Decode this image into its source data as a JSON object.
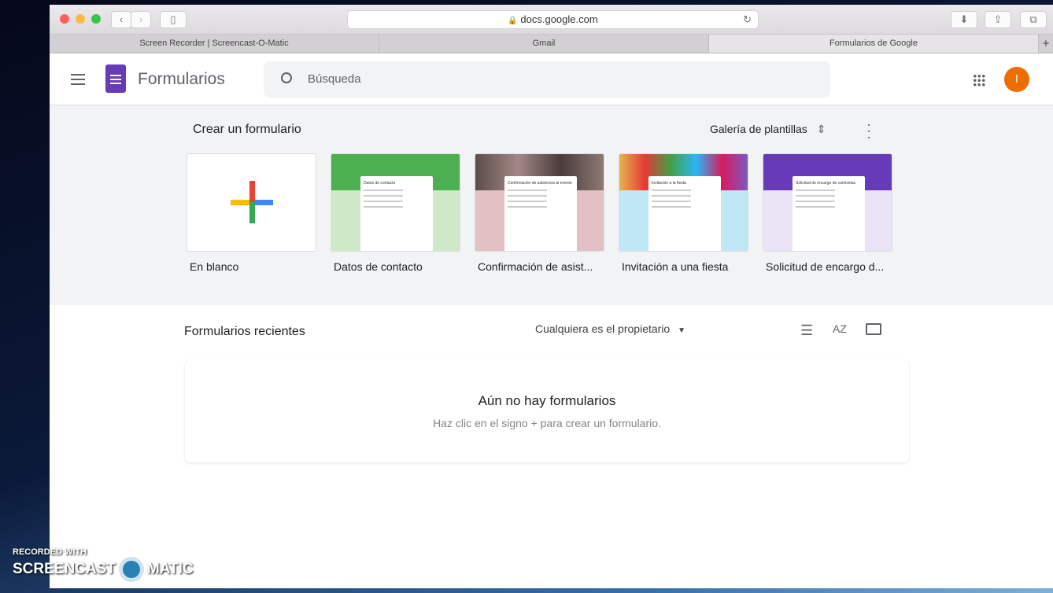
{
  "browser": {
    "url": "docs.google.com",
    "tabs": [
      "Screen Recorder | Screencast-O-Matic",
      "Gmail",
      "Formularios de Google"
    ],
    "new_tab": "+"
  },
  "app": {
    "name": "Formularios",
    "search_placeholder": "Búsqueda",
    "avatar_initial": "I"
  },
  "gallery": {
    "title": "Crear un formulario",
    "gallery_button": "Galería de plantillas",
    "templates": [
      {
        "label": "En blanco",
        "color": "#ffffff"
      },
      {
        "label": "Datos de contacto",
        "color": "#cfe8c8",
        "header": "#4caf50",
        "form_title": "Datos de contacto"
      },
      {
        "label": "Confirmación de asist...",
        "color": "#e2c0c4",
        "header": "#6d5a5a",
        "form_title": "Confirmación de asistencia al evento"
      },
      {
        "label": "Invitación a una fiesta",
        "color": "#bfe7f5",
        "header": "#c9b9a0",
        "form_title": "Invitación a la fiesta"
      },
      {
        "label": "Solicitud de encargo d...",
        "color": "#ebe3f6",
        "header": "#673ab7",
        "form_title": "Solicitud de encargo de camisetas"
      }
    ]
  },
  "recent": {
    "title": "Formularios recientes",
    "owner_filter": "Cualquiera es el propietario",
    "empty_title": "Aún no hay formularios",
    "empty_subtitle": "Haz clic en el signo + para crear un formulario."
  },
  "watermark": {
    "line1": "RECORDED WITH",
    "line2a": "SCREENCAST",
    "line2b": "MATIC"
  }
}
